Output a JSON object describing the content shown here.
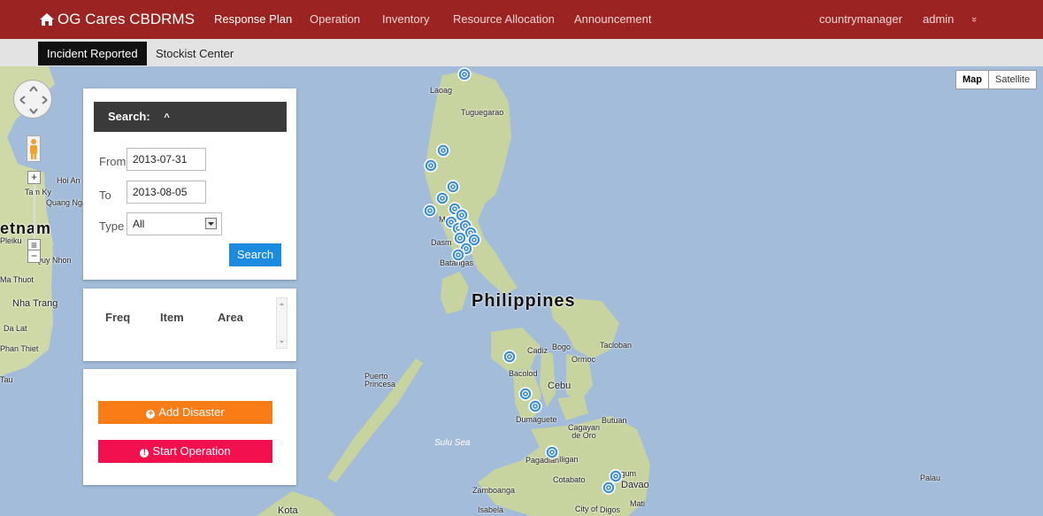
{
  "app": {
    "title": "OG Cares CBDRMS"
  },
  "nav": {
    "items": [
      "Response Plan",
      "Operation",
      "Inventory",
      "Resource Allocation",
      "Announcement"
    ],
    "user": "countrymanager",
    "role": "admin",
    "more": "»"
  },
  "subnav": {
    "tabs": [
      "Incident Reported",
      "Stockist Center"
    ]
  },
  "search": {
    "title": "Search:",
    "from_label": "From",
    "from_value": "2013-07-31",
    "to_label": "To",
    "to_value": "2013-08-05",
    "type_label": "Type",
    "type_value": "All",
    "button": "Search"
  },
  "table": {
    "headers": [
      "Freq",
      "Item",
      "Area"
    ]
  },
  "actions": {
    "add": "Add Disaster",
    "start": "Start Operation"
  },
  "map": {
    "types": [
      "Map",
      "Satellite"
    ],
    "labels": {
      "laoag": "Laoag",
      "tuguegarao": "Tuguegarao",
      "philippines": "Philippines",
      "batangas": "Batangas",
      "dasma": "Dasm",
      "manila": "M",
      "cadiz": "Cadiz",
      "bogo": "Bogo",
      "tacloban": "Tacloban",
      "ormoc": "Ormoc",
      "bacolod": "Bacolod",
      "cebu": "Cebu",
      "puerto_princesa": "Puerto Princesa",
      "dumaguete": "Dumaguete",
      "butuan": "Butuan",
      "cagayan": "Cagayan de Oro",
      "sulu_sea": "Sulu Sea",
      "pagadian": "Pagadian",
      "iligan": "Iligan",
      "tagum": "Tagum",
      "davao": "Davao",
      "cotabato": "Cotabato",
      "mati": "Mati",
      "zamboanga": "Zamboanga",
      "isabela": "Isabela",
      "city_of": "City of",
      "digos": "Digos",
      "palau": "Palau",
      "kota": "Kota",
      "vietnam": "etnam",
      "nha_trang": "Nha Trang",
      "hoi_an": "Hoi An",
      "tam_ky": "Tam Ky",
      "quang_ngai": "Quang Ngai",
      "pleiku": "Pleiku",
      "quy_nhon": "Quy Nhon",
      "ma_thuot": "Ma Thuot",
      "da_lat": "Da Lat",
      "phan_thiet": "Phan Thiet",
      "tau": "Tau"
    },
    "colors": {
      "marker": "#3d8fd6",
      "land": "#c9d6a0",
      "water": "#a3bcd9"
    }
  }
}
